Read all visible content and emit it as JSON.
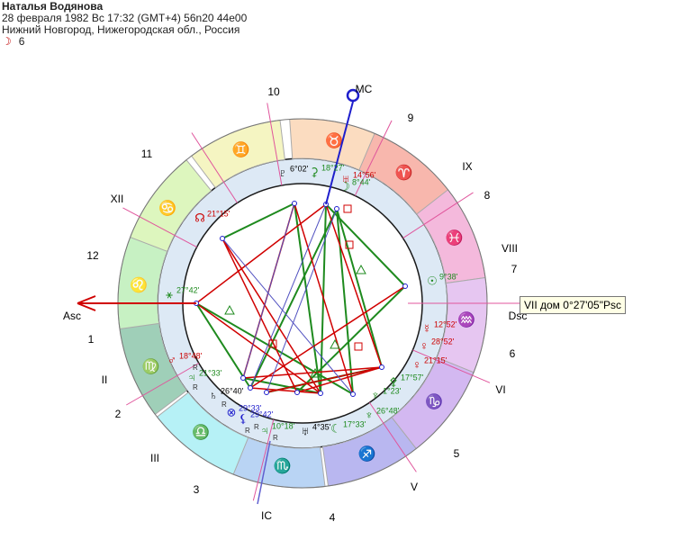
{
  "header": {
    "name": "Наталья Водянова",
    "datetime": "28 февраля 1982  Вс  17:32 (GMT+4) 56n20  44e00",
    "place": "Нижний Новгород, Нижегородская обл., Россия",
    "moon_symbol": "☽",
    "moon_value": "6"
  },
  "tooltip": {
    "text": "VII дом  0°27'05\"Psc"
  },
  "axes": {
    "asc": "Asc",
    "dsc": "Dsc",
    "mc": "MC",
    "ic": "IC"
  },
  "zodiac": [
    {
      "glyph": "♉",
      "color": "#fbdcc0"
    },
    {
      "glyph": "♈",
      "color": "#f8b7ad"
    },
    {
      "glyph": "♓",
      "color": "#f4b9dc"
    },
    {
      "glyph": "♒",
      "color": "#e6c6f1"
    },
    {
      "glyph": "♑",
      "color": "#d3b8f1"
    },
    {
      "glyph": "♐",
      "color": "#b9b7f0"
    },
    {
      "glyph": "♏",
      "color": "#b9d4f4"
    },
    {
      "glyph": "♎",
      "color": "#b6f1f6"
    },
    {
      "glyph": "♍",
      "color": "#9fcfb8"
    },
    {
      "glyph": "♌",
      "color": "#c7f1c3"
    },
    {
      "glyph": "♋",
      "color": "#ddf6be"
    },
    {
      "glyph": "♊",
      "color": "#f5f5c2"
    }
  ],
  "houses": {
    "roman": [
      "VIII",
      "IX",
      "XII",
      "II",
      "III",
      "V",
      "VI"
    ],
    "arabic": [
      "9",
      "8",
      "7",
      "6",
      "5",
      "4",
      "3",
      "2",
      "1",
      "12",
      "11",
      "10"
    ]
  },
  "planets": [
    {
      "glyph": "♇",
      "label": "6°02'",
      "color": "#000000"
    },
    {
      "glyph": "⚳",
      "label": "18°27'",
      "color": "#1e8a1e"
    },
    {
      "glyph": "♅",
      "label": "14°56'",
      "color": "#cc0000"
    },
    {
      "glyph": "☽",
      "label": "8°44'",
      "color": "#1e8a1e"
    },
    {
      "glyph": "☊",
      "label": "21°15'",
      "color": "#cc0000"
    },
    {
      "glyph": "⚹",
      "label": "27°42'",
      "color": "#1e8a1e"
    },
    {
      "glyph": "☉",
      "label": "9°38'",
      "color": "#1e8a1e"
    },
    {
      "glyph": "☿",
      "label": "12°52'",
      "color": "#cc0000"
    },
    {
      "glyph": "♀",
      "label": "28°52'",
      "color": "#cc0000"
    },
    {
      "glyph": "♀",
      "label": "21°15'",
      "color": "#cc0000"
    },
    {
      "glyph": "⚴",
      "label": "17°57'",
      "color": "#1e8a1e"
    },
    {
      "glyph": "♆",
      "label": "1°23'",
      "color": "#1e8a1e"
    },
    {
      "glyph": "♆",
      "label": "26°48'",
      "color": "#1e8a1e"
    },
    {
      "glyph": "☾",
      "label": "17°33'",
      "color": "#1e8a1e"
    },
    {
      "glyph": "♅",
      "label": "4°35'",
      "color": "#000000"
    },
    {
      "glyph": "♃",
      "label": "10°18'",
      "color": "#1e8a1e"
    },
    {
      "glyph": "⚸",
      "label": "29°42'",
      "color": "#1e1ecc"
    },
    {
      "glyph": "⊗",
      "label": "29°33'",
      "color": "#1e1ecc"
    },
    {
      "glyph": "♄",
      "label": "26°40'",
      "color": "#000000"
    },
    {
      "glyph": "♃",
      "label": "21°33'",
      "color": "#1e8a1e"
    },
    {
      "glyph": "♂",
      "label": "18°48'",
      "color": "#cc0000"
    }
  ],
  "retrograde_mark": "R"
}
